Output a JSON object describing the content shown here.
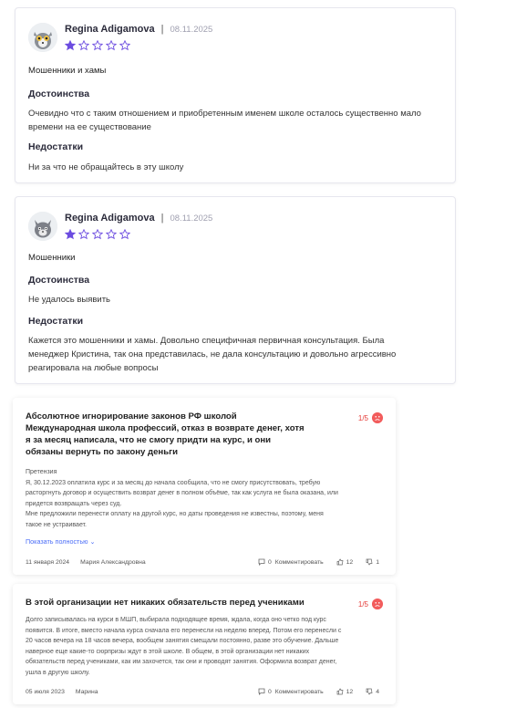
{
  "reviews": [
    {
      "name": "Regina Adigamova",
      "separator": "|",
      "date": "08.11.2025",
      "rating": 1,
      "max_rating": 5,
      "title": "Мошенники и хамы",
      "pros_heading": "Достоинства",
      "pros_line1": "Очевидно что с таким отношением и приобретенным именем школе осталось существенно мало",
      "pros_line2": "времени на ее существование",
      "cons_heading": "Недостатки",
      "cons_line1": "Ни за что не обращайтесь в эту школу"
    },
    {
      "name": "Regina Adigamova",
      "separator": "|",
      "date": "08.11.2025",
      "rating": 1,
      "max_rating": 5,
      "title": "Мошенники",
      "pros_heading": "Достоинства",
      "pros_line1": "Не удалось выявить",
      "cons_heading": "Недостатки",
      "cons_line1": "Кажется это мошенники и хамы. Довольно специфичная первичная консультация. Была",
      "cons_line2": "менеджер Кристина, так она представилась, не дала консультацию и довольно агрессивно",
      "cons_line3": "реагировала на любые вопросы"
    }
  ],
  "feed": [
    {
      "title_line1": "Абсолютное игнорирование законов РФ школой",
      "title_line2": "Международная школа профессий, отказ в возврате денег, хотя",
      "title_line3": "я за месяц написала, что не смогу придти на курс, и они",
      "title_line4": "обязаны вернуть по закону деньги",
      "rating": "1/5",
      "body": [
        "Претензия",
        "Я, 30.12.2023 оплатила курс и за месяц до начала сообщила, что не смогу присутствовать, требую",
        "расторгнуть договор и осуществить возврат денег в полном объёме, так как услуга не была оказана, или",
        "придется возвращать через суд.",
        "Мне предложили перенести оплату на другой курс, но даты проведения не известны, поэтому, меня",
        "такое не устраивает."
      ],
      "show_more": "Показать полностью ⌄",
      "date": "11 января 2024",
      "author": "Мария Александровна",
      "comments_count": "0",
      "comment_label": "Комментировать",
      "likes": "12",
      "dislikes": "1"
    },
    {
      "title_line1": "В этой организации нет никаких обязательств перед учениками",
      "rating": "1/5",
      "body": [
        "Долго записывалась на курси в МШП, выбирала подходящее время, ждала, когда оно четко под курс",
        "появится. В итоге, вместо начала курса сначала его перенесли на неделю вперед. Потом его перенесли с",
        "20 часов вечера на 18 часов вечера, вообщем занятия смещали постоянно, разве это обучение. Дальше",
        "наверное еще какие-то сюрпризы ждут в этой школе. В общем, в этой организации нет никаких",
        "обязательств перед учениками, как им захочется, так они и проводят занятия. Оформила возврат денег,",
        "ушла в другую школу."
      ],
      "date": "05 июля 2023",
      "author": "Марина",
      "comments_count": "0",
      "comment_label": "Комментировать",
      "likes": "12",
      "dislikes": "4"
    }
  ],
  "colors": {
    "star_filled": "#6c4ce0",
    "star_empty": "#6c4ce0",
    "rating_red": "#e53935",
    "link_blue": "#4a6cf7"
  }
}
